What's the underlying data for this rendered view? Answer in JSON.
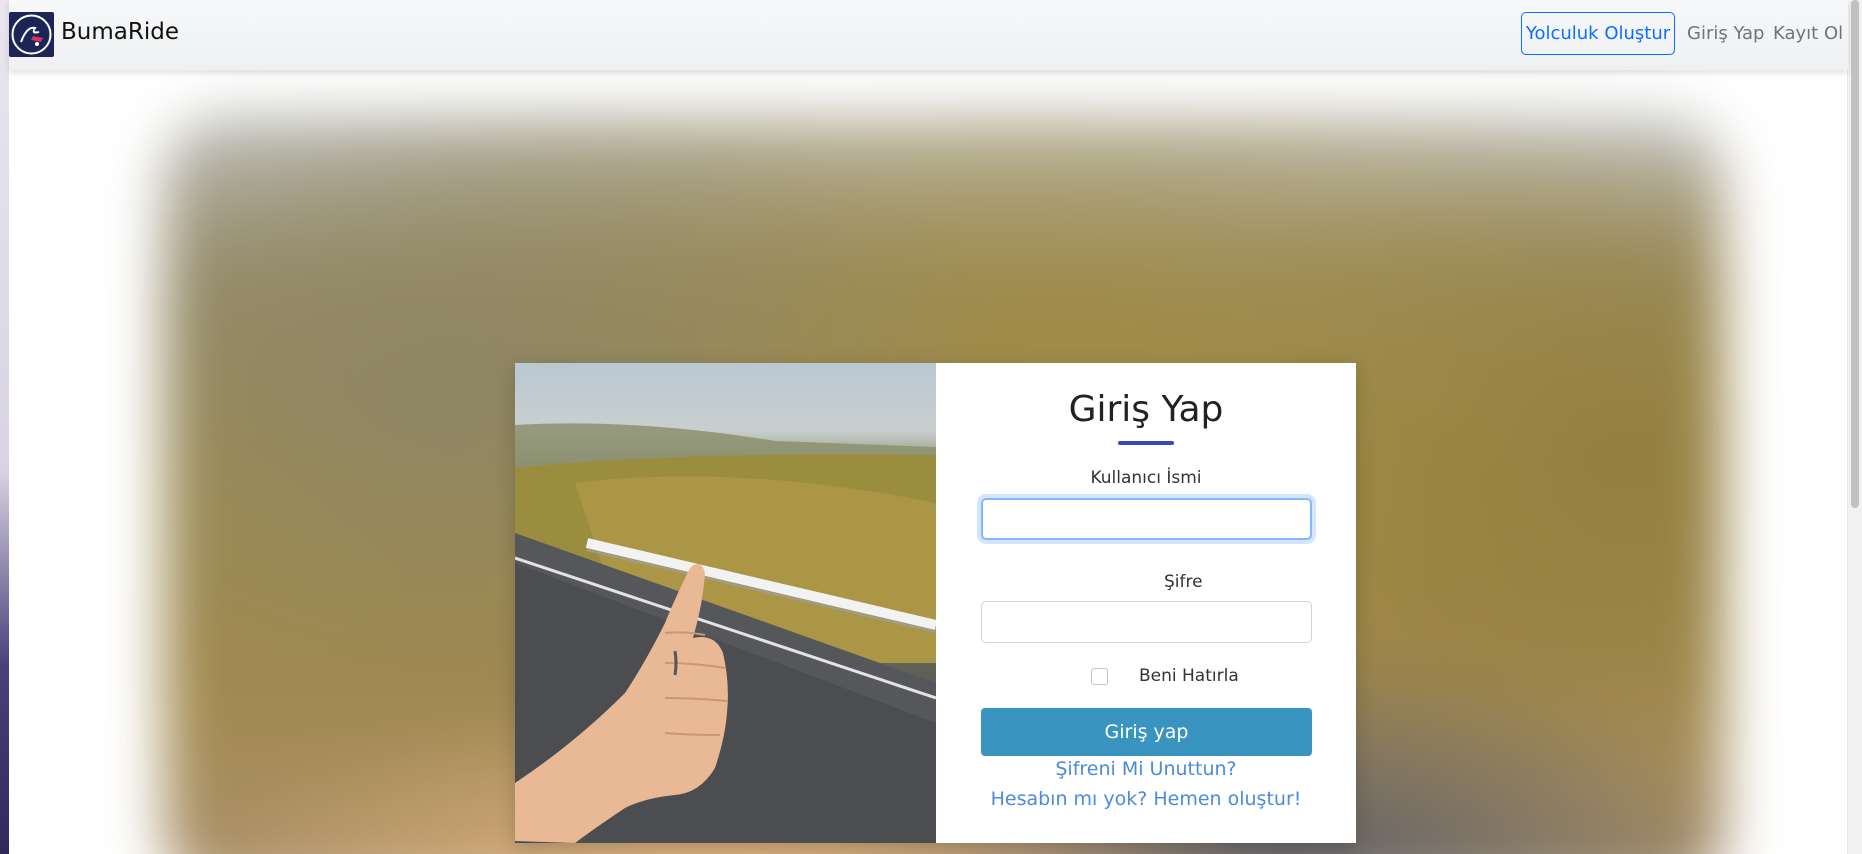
{
  "navbar": {
    "brand": "BumaRide",
    "create_ride": "Yolculuk Oluştur",
    "login": "Giriş Yap",
    "register": "Kayıt Ol"
  },
  "login_form": {
    "title": "Giriş Yap",
    "username_label": "Kullanıcı İsmi",
    "username_value": "",
    "password_label": "Şifre",
    "password_value": "",
    "remember_label": "Beni Hatırla",
    "remember_checked": false,
    "submit_label": "Giriş yap",
    "forgot_link": "Şifreni Mi Unuttun?",
    "signup_link": "Hesabın mı yok? Hemen oluştur!"
  },
  "colors": {
    "accent": "#3a94c0",
    "link": "#4a8bdc",
    "nav_outline": "#0d6efd",
    "title_underline": "#3b47b4"
  },
  "icons": {
    "logo": "hitchhiker-logo-icon"
  }
}
